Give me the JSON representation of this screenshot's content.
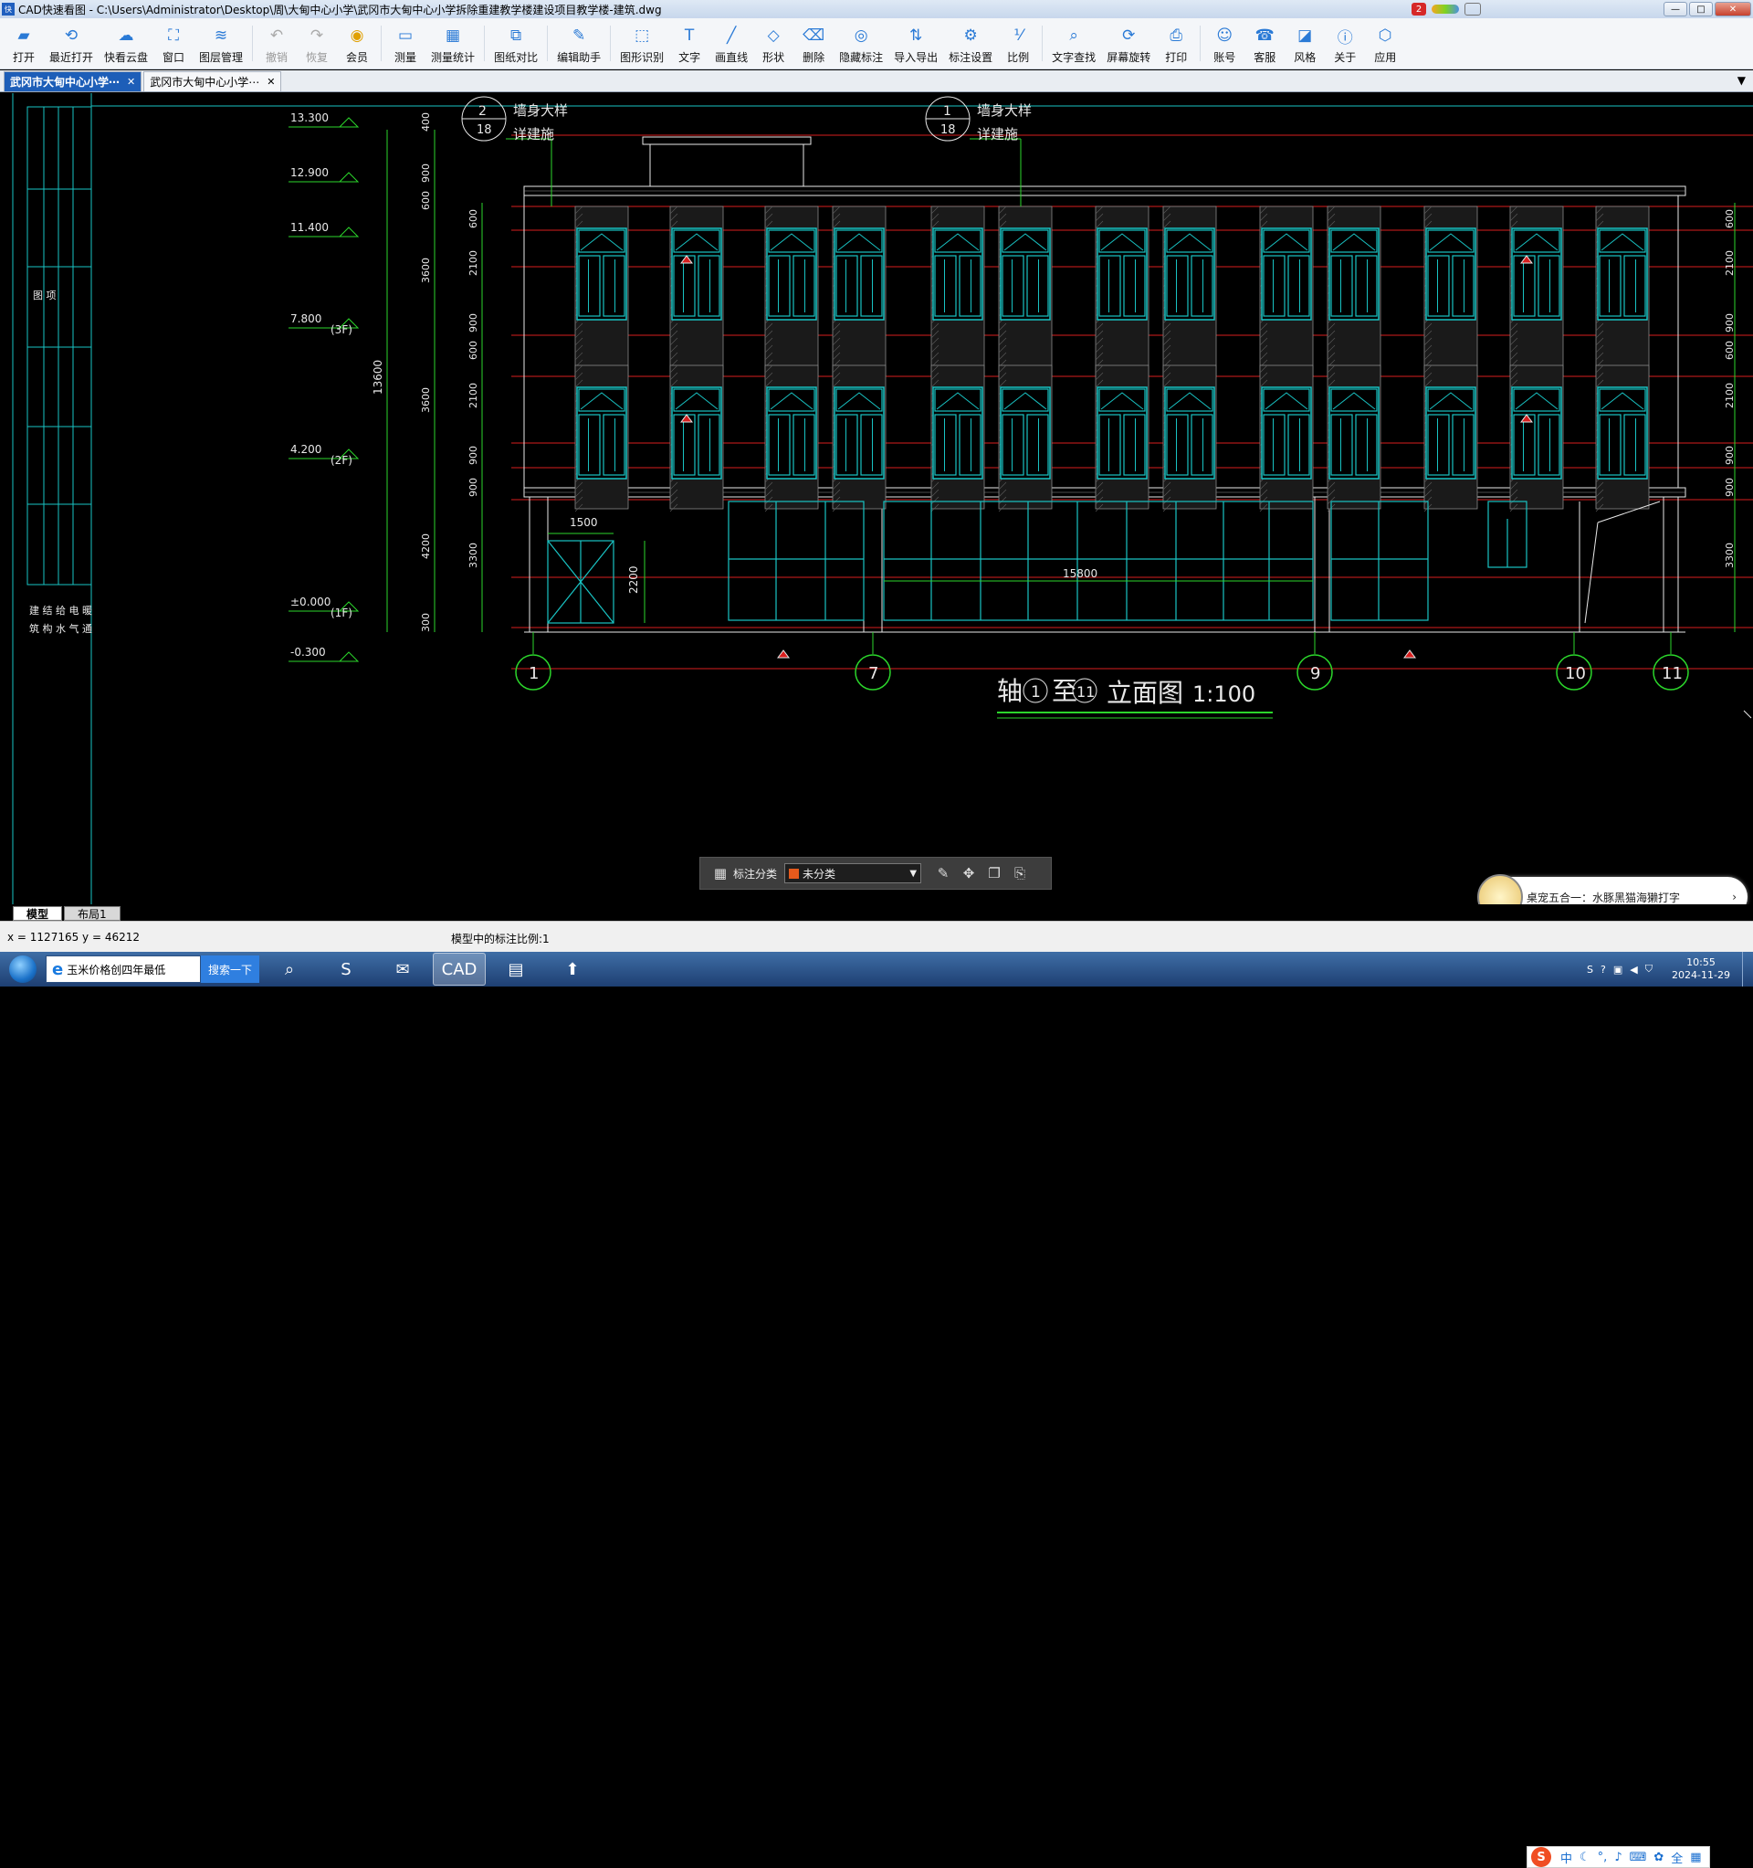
{
  "window": {
    "title": "CAD快速看图 - C:\\Users\\Administrator\\Desktop\\周\\大甸中心小学\\武冈市大甸中心小学拆除重建教学楼建设项目教学楼-建筑.dwg",
    "notif_count": "2",
    "min_label": "—",
    "max_label": "□",
    "close_label": "✕"
  },
  "toolbar": [
    {
      "label": "打开",
      "icon": "folder-icon",
      "glyph": "▰",
      "state": "normal"
    },
    {
      "label": "最近打开",
      "icon": "history-icon",
      "glyph": "⟲",
      "state": "normal"
    },
    {
      "label": "快看云盘",
      "icon": "cloud-icon",
      "glyph": "☁",
      "state": "normal"
    },
    {
      "label": "窗口",
      "icon": "window-icon",
      "glyph": "⛶",
      "state": "normal"
    },
    {
      "label": "图层管理",
      "icon": "layers-icon",
      "glyph": "≋",
      "state": "normal"
    },
    {
      "label": "撤销",
      "icon": "undo-icon",
      "glyph": "↶",
      "state": "dim"
    },
    {
      "label": "恢复",
      "icon": "redo-icon",
      "glyph": "↷",
      "state": "dim"
    },
    {
      "label": "会员",
      "icon": "vip-icon",
      "glyph": "◉",
      "state": "vip"
    },
    {
      "label": "测量",
      "icon": "ruler-icon",
      "glyph": "▭",
      "state": "normal"
    },
    {
      "label": "测量统计",
      "icon": "stats-icon",
      "glyph": "▦",
      "state": "normal"
    },
    {
      "label": "图纸对比",
      "icon": "compare-icon",
      "glyph": "⧉",
      "state": "normal"
    },
    {
      "label": "编辑助手",
      "icon": "edit-helper-icon",
      "glyph": "✎",
      "state": "normal"
    },
    {
      "label": "图形识别",
      "icon": "recognize-icon",
      "glyph": "⬚",
      "state": "normal"
    },
    {
      "label": "文字",
      "icon": "text-icon",
      "glyph": "T",
      "state": "normal"
    },
    {
      "label": "画直线",
      "icon": "line-icon",
      "glyph": "╱",
      "state": "normal"
    },
    {
      "label": "形状",
      "icon": "shape-icon",
      "glyph": "◇",
      "state": "normal"
    },
    {
      "label": "删除",
      "icon": "eraser-icon",
      "glyph": "⌫",
      "state": "normal"
    },
    {
      "label": "隐藏标注",
      "icon": "hide-icon",
      "glyph": "◎",
      "state": "normal"
    },
    {
      "label": "导入导出",
      "icon": "import-export-icon",
      "glyph": "⇅",
      "state": "normal"
    },
    {
      "label": "标注设置",
      "icon": "annotation-settings-icon",
      "glyph": "⚙",
      "state": "normal"
    },
    {
      "label": "比例",
      "icon": "scale-icon",
      "glyph": "⅟",
      "state": "normal"
    },
    {
      "label": "文字查找",
      "icon": "find-text-icon",
      "glyph": "⌕",
      "state": "normal"
    },
    {
      "label": "屏幕旋转",
      "icon": "rotate-icon",
      "glyph": "⟳",
      "state": "normal"
    },
    {
      "label": "打印",
      "icon": "print-icon",
      "glyph": "⎙",
      "state": "normal"
    },
    {
      "label": "账号",
      "icon": "account-icon",
      "glyph": "☺",
      "state": "normal"
    },
    {
      "label": "客服",
      "icon": "headset-icon",
      "glyph": "☎",
      "state": "normal"
    },
    {
      "label": "风格",
      "icon": "style-icon",
      "glyph": "◪",
      "state": "normal"
    },
    {
      "label": "关于",
      "icon": "info-icon",
      "glyph": "ⓘ",
      "state": "normal"
    },
    {
      "label": "应用",
      "icon": "apps-icon",
      "glyph": "⬡",
      "state": "normal"
    }
  ],
  "file_tabs": [
    {
      "label": "武冈市大甸中心小学⋯",
      "active": true
    },
    {
      "label": "武冈市大甸中心小学⋯",
      "active": false
    }
  ],
  "drawing": {
    "elevations": [
      {
        "label": "13.300",
        "floor": ""
      },
      {
        "label": "12.900",
        "floor": ""
      },
      {
        "label": "11.400",
        "floor": ""
      },
      {
        "label": "7.800",
        "floor": "(3F)"
      },
      {
        "label": "4.200",
        "floor": "(2F)"
      },
      {
        "label": "±0.000",
        "floor": "(1F)"
      },
      {
        "label": "-0.300",
        "floor": ""
      }
    ],
    "total_height": "13600",
    "left_dims_outer": [
      "400",
      "900",
      "600",
      "3600",
      "3600",
      "4200",
      "300"
    ],
    "left_dims_inner": [
      "600",
      "2100",
      "900",
      "600",
      "2100",
      "900",
      "900",
      "3300"
    ],
    "right_dims": [
      "600",
      "2100",
      "900",
      "600",
      "2100",
      "900",
      "900",
      "3300"
    ],
    "detail_callouts": [
      {
        "num": "2",
        "sheet": "18",
        "text1": "墙身大样",
        "text2": "详建施"
      },
      {
        "num": "1",
        "sheet": "18",
        "text1": "墙身大样",
        "text2": "详建施"
      }
    ],
    "door_width": "1500",
    "door_height": "2200",
    "storefront_width": "15800",
    "axes": [
      "1",
      "7",
      "9",
      "10",
      "11"
    ],
    "title_prefix": "轴",
    "title_from": "1",
    "title_mid": "至",
    "title_to": "11",
    "title_suffix": "立面图",
    "title_scale": "1:100",
    "left_panel_text1": "图 项",
    "left_panel_text2": "建 结 给 电 暖",
    "left_panel_text3": "筑 构 水 气 通"
  },
  "annotation_bar": {
    "label": "标注分类",
    "selected": "未分类",
    "swatch_color": "#e65a1c"
  },
  "layout_tabs": [
    {
      "label": "模型",
      "active": true
    },
    {
      "label": "布局1",
      "active": false
    }
  ],
  "status": {
    "coords": "x = 1127165   y = 46212",
    "scale_text": "模型中的标注比例:1"
  },
  "pet_popup": {
    "text": "桌宠五合一：水豚黑猫海獭打字"
  },
  "ime": {
    "mode": "中"
  },
  "taskbar": {
    "ie_text": "玉米价格创四年最低",
    "search_label": "搜索一下",
    "time": "10:55",
    "date": "2024-11-29",
    "cad_label": "CAD"
  },
  "colors": {
    "cyan": "#19c3c3",
    "green": "#2bd62b",
    "red": "#d81e1e",
    "white": "#e8e8e8",
    "yellow": "#d8d800"
  }
}
